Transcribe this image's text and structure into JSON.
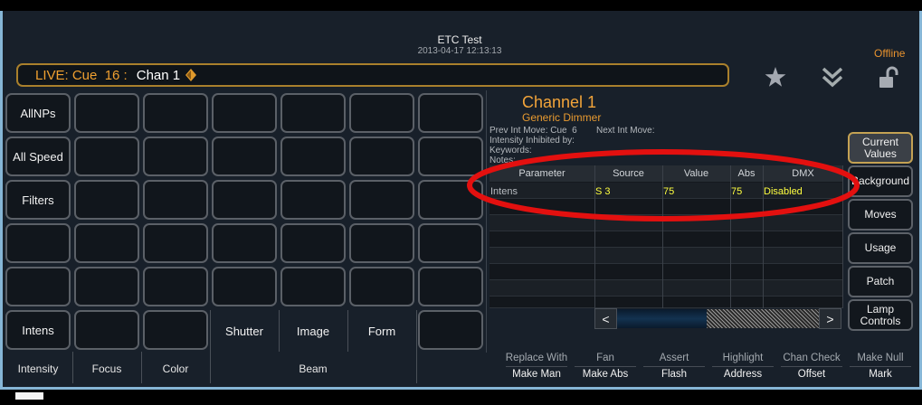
{
  "header": {
    "title": "ETC Test",
    "timestamp": "2013-04-17 12:13:13",
    "status": "Offline"
  },
  "command_line": {
    "prefix": "LIVE: Cue  16 :",
    "target": "Chan 1",
    "end_icon": "diamond-icon"
  },
  "toolbar": {
    "favorite_icon": "star-icon",
    "expand_icon": "double-chevron-down-icon",
    "lock_icon": "unlocked-padlock-icon"
  },
  "param_grid": {
    "rows": [
      [
        "AllNPs",
        "",
        "",
        "",
        "",
        "",
        ""
      ],
      [
        "All Speed",
        "",
        "",
        "",
        "",
        "",
        ""
      ],
      [
        "Filters",
        "",
        "",
        "",
        "",
        "",
        ""
      ],
      [
        "",
        "",
        "",
        "",
        "",
        "",
        ""
      ],
      [
        "",
        "",
        "",
        "",
        "",
        "",
        ""
      ],
      [
        "Intens",
        "",
        "",
        "Shutter",
        "Image",
        "Form",
        ""
      ]
    ],
    "categories": [
      "Intensity",
      "Focus",
      "Color",
      "Beam"
    ]
  },
  "channel": {
    "title": "Channel 1",
    "type": "Generic Dimmer",
    "prev_int_move": "Prev Int Move: Cue  6",
    "next_int_move": "Next Int Move:",
    "inhibited": "Intensity Inhibited by:",
    "keywords": "Keywords:",
    "notes": "Notes:"
  },
  "table": {
    "columns": [
      "Parameter",
      "Source",
      "Value",
      "Abs",
      "DMX"
    ],
    "rows": [
      [
        "Intens",
        "S 3",
        "75",
        "75",
        "Disabled"
      ]
    ]
  },
  "scrollbar": {
    "left": "<",
    "right": ">"
  },
  "display_buttons": [
    {
      "label": "Current Values",
      "selected": true
    },
    {
      "label": "Background",
      "selected": false
    },
    {
      "label": "Moves",
      "selected": false
    },
    {
      "label": "Usage",
      "selected": false
    },
    {
      "label": "Patch",
      "selected": false
    },
    {
      "label": "Lamp Controls",
      "selected": false
    }
  ],
  "softkeys": [
    {
      "top": "Replace With",
      "bottom": "Make Man"
    },
    {
      "top": "Fan",
      "bottom": "Make Abs"
    },
    {
      "top": "Assert",
      "bottom": "Flash"
    },
    {
      "top": "Highlight",
      "bottom": "Address"
    },
    {
      "top": "Chan Check",
      "bottom": "Offset"
    },
    {
      "top": "Make Null",
      "bottom": "Mark"
    }
  ],
  "colors": {
    "accent": "#f0a030",
    "value_text": "#ffff40",
    "selected_border": "#c4a253",
    "window_border": "#86b6d6",
    "annotation": "#e3100f"
  }
}
